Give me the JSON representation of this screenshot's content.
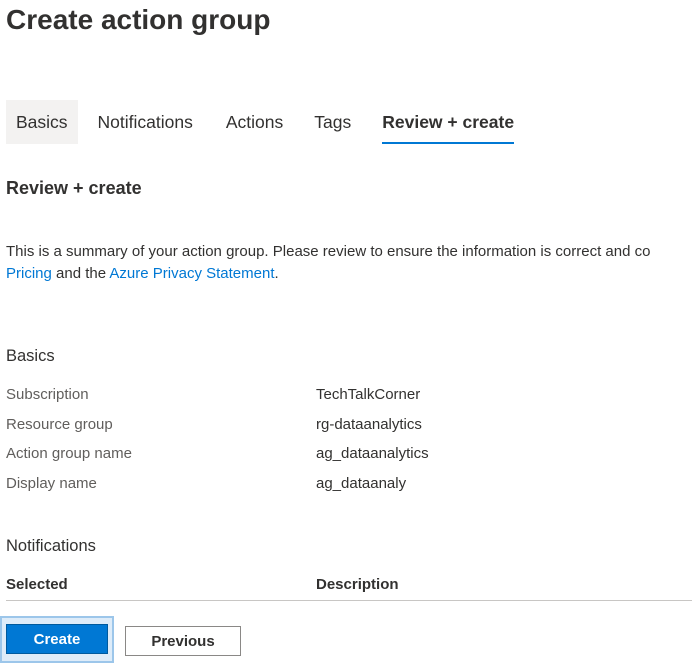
{
  "page": {
    "title": "Create action group"
  },
  "tabs": [
    {
      "label": "Basics"
    },
    {
      "label": "Notifications"
    },
    {
      "label": "Actions"
    },
    {
      "label": "Tags"
    },
    {
      "label": "Review + create"
    }
  ],
  "active_tab": "Review + create",
  "review": {
    "heading": "Review + create",
    "summary_text": "This is a summary of your action group. Please review to ensure the information is correct and co",
    "pricing_link": "Pricing",
    "and_the": "and the",
    "privacy_link": "Azure Privacy Statement",
    "period": "."
  },
  "basics": {
    "title": "Basics",
    "fields": [
      {
        "label": "Subscription",
        "value": "TechTalkCorner"
      },
      {
        "label": "Resource group",
        "value": "rg-dataanalytics"
      },
      {
        "label": "Action group name",
        "value": "ag_dataanalytics"
      },
      {
        "label": "Display name",
        "value": "ag_dataanaly"
      }
    ]
  },
  "notifications": {
    "title": "Notifications",
    "columns": [
      "Selected",
      "Description"
    ]
  },
  "footer": {
    "create_label": "Create",
    "previous_label": "Previous"
  },
  "colors": {
    "accent": "#0078d4",
    "text": "#323130",
    "secondary_text": "#605e5c"
  }
}
